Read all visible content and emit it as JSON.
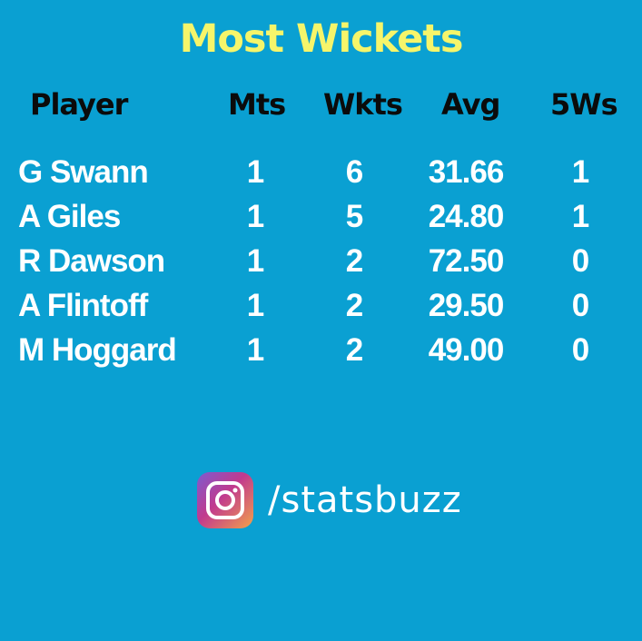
{
  "title": "Most Wickets",
  "headers": {
    "player": "Player",
    "mts": "Mts",
    "wkts": "Wkts",
    "avg": "Avg",
    "five_ws": "5Ws"
  },
  "rows": [
    {
      "player": "G Swann",
      "mts": "1",
      "wkts": "6",
      "avg": "31.66",
      "five_ws": "1"
    },
    {
      "player": "A Giles",
      "mts": "1",
      "wkts": "5",
      "avg": "24.80",
      "five_ws": "1"
    },
    {
      "player": "R Dawson",
      "mts": "1",
      "wkts": "2",
      "avg": "72.50",
      "five_ws": "0"
    },
    {
      "player": "A Flintoff",
      "mts": "1",
      "wkts": "2",
      "avg": "29.50",
      "five_ws": "0"
    },
    {
      "player": "M Hoggard",
      "mts": "1",
      "wkts": "2",
      "avg": "49.00",
      "five_ws": "0"
    }
  ],
  "social": {
    "icon": "instagram-icon",
    "handle": "/statsbuzz"
  },
  "colors": {
    "background": "#0aa0d2",
    "title": "#f6f56a",
    "header_text": "#0b0b0b",
    "row_text": "#ffffff"
  }
}
